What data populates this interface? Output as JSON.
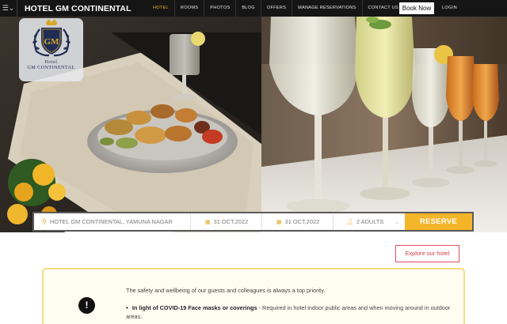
{
  "nav": {
    "menu_icon": "hamburger-icon",
    "brand": "HOTEL GM CONTINENTAL",
    "links": [
      {
        "label": "HOTEL",
        "active": true
      },
      {
        "label": "ROOMS",
        "active": false
      },
      {
        "label": "PHOTOS",
        "active": false
      },
      {
        "label": "BLOG",
        "active": false
      },
      {
        "label": "OFFERS",
        "active": false
      },
      {
        "label": "MANAGE RESERVATIONS",
        "active": false
      },
      {
        "label": "CONTACT US",
        "active": false
      }
    ],
    "book_now": "Book Now",
    "login": "LOGIN"
  },
  "hero": {
    "logo": {
      "line1": "Hotel",
      "line2": "GM CONTINENTAL",
      "monogram": "GM"
    }
  },
  "booking": {
    "hotel": "HOTEL GM CONTINENTAL, YAMUNA NAGAR",
    "check_in": "31 OCT,2022",
    "check_out": "31 OCT,2022",
    "guests": "2 ADULTS",
    "reserve": "RESERVE",
    "accent": "#f5b52a"
  },
  "explore": {
    "label": "Explore our hotel"
  },
  "notice": {
    "intro": "The safety and wellbeing of our guests and colleagues is always a top priority.",
    "item_bold": "In light of COVID-19 Face masks or coverings",
    "item_rest": " - Required in hotel indoor public areas and when moving around in outdoor areas."
  }
}
